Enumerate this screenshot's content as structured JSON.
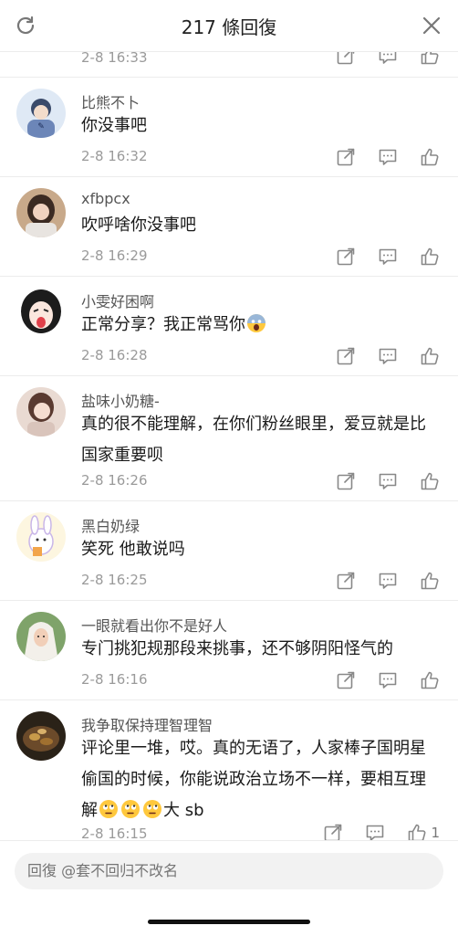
{
  "header": {
    "title": "217 條回復"
  },
  "partial": {
    "time": "2-8 16:33"
  },
  "comments": [
    {
      "name": "比熊不卜",
      "text": "你没事吧",
      "time": "2-8 16:32"
    },
    {
      "name": "xfbpcx",
      "text": "吹呼啥你没事吧",
      "time": "2-8 16:29"
    },
    {
      "name": "小雯好困啊",
      "text": "正常分享？我正常骂你",
      "time": "2-8 16:28"
    },
    {
      "name": "盐味小奶糖-",
      "text": "真的很不能理解，在你们粉丝眼里，爱豆就是比国家重要呗",
      "time": "2-8 16:26"
    },
    {
      "name": "黑白奶绿",
      "text": "笑死 他敢说吗",
      "time": "2-8 16:25"
    },
    {
      "name": "一眼就看出你不是好人",
      "text": "专门挑犯规那段来挑事，还不够阴阳怪气的",
      "time": "2-8 16:16"
    },
    {
      "name": "我争取保持理智理智",
      "text_a": "评论里一堆，哎。真的无语了，人家棒子国明星偷国的时候，你能说政治立场不一样，要相互理解",
      "text_b": "大 sb",
      "time": "2-8 16:15",
      "likes": "1"
    }
  ],
  "reply": {
    "placeholder": "回復 @套不回归不改名"
  },
  "icons": [
    "refresh-icon",
    "close-icon",
    "share-icon",
    "comment-icon",
    "like-icon",
    "emoji-icon"
  ],
  "colors": {
    "text": "#1a1a1a",
    "meta": "#9a9a9a",
    "icon": "#888888",
    "divider": "#ececec"
  }
}
